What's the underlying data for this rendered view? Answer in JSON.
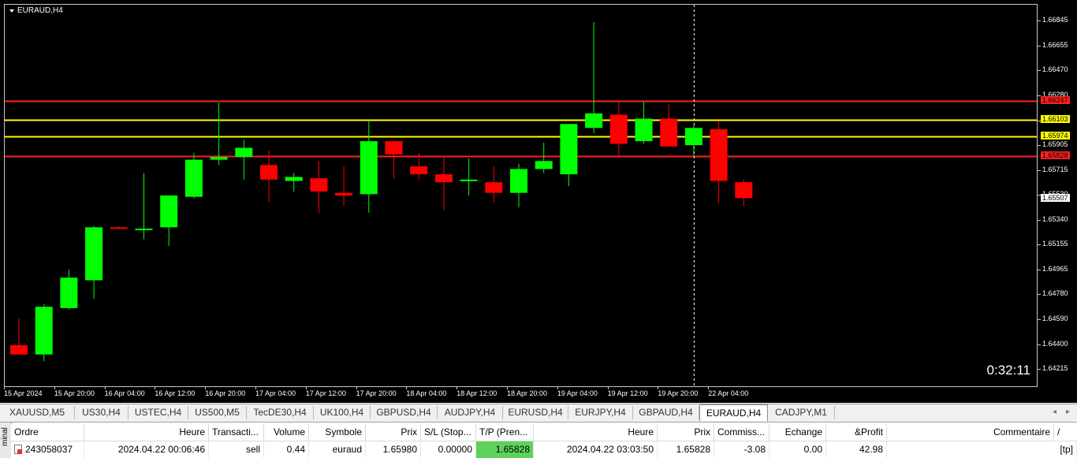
{
  "chart": {
    "title": "EURAUD,H4",
    "countdown": "0:32:11",
    "colors": {
      "bull": "#00ff00",
      "bear": "#ff0000",
      "background": "#000000",
      "wick_bull": "#00ff00",
      "wick_bear": "#ff0000"
    },
    "price_ticks": [
      "1.66845",
      "1.66655",
      "1.66470",
      "1.66280",
      "1.66090",
      "1.65905",
      "1.65715",
      "1.65530",
      "1.65340",
      "1.65155",
      "1.64965",
      "1.64780",
      "1.64590",
      "1.64400",
      "1.64215"
    ],
    "price_labels": [
      {
        "text": "1.66247",
        "bg": "#ff2020",
        "fg": "#000000"
      },
      {
        "text": "1.66103",
        "bg": "#ffff00",
        "fg": "#000000"
      },
      {
        "text": "1.65974",
        "bg": "#ffff00",
        "fg": "#000000"
      },
      {
        "text": "1.65828",
        "bg": "#ff2020",
        "fg": "#000000"
      },
      {
        "text": "1.65507",
        "bg": "#ffffff",
        "fg": "#000000"
      }
    ],
    "time_labels": [
      "15 Apr 2024",
      "15 Apr 20:00",
      "16 Apr 04:00",
      "16 Apr 12:00",
      "16 Apr 20:00",
      "17 Apr 04:00",
      "17 Apr 12:00",
      "17 Apr 20:00",
      "18 Apr 04:00",
      "18 Apr 12:00",
      "18 Apr 20:00",
      "19 Apr 04:00",
      "19 Apr 12:00",
      "19 Apr 20:00",
      "22 Apr 04:00"
    ]
  },
  "chart_data": {
    "type": "candlestick",
    "symbol": "EURAUD",
    "timeframe": "H4",
    "ylim": [
      1.6415,
      1.669
    ],
    "hlines": [
      {
        "price": 1.66247,
        "color": "#ff2020"
      },
      {
        "price": 1.66103,
        "color": "#ffff00"
      },
      {
        "price": 1.65974,
        "color": "#ffff00"
      },
      {
        "price": 1.65828,
        "color": "#ff2020"
      }
    ],
    "candles": [
      {
        "o": 1.644,
        "h": 1.646,
        "l": 1.6433,
        "c": 1.6433
      },
      {
        "o": 1.6433,
        "h": 1.6471,
        "l": 1.6428,
        "c": 1.6469
      },
      {
        "o": 1.6468,
        "h": 1.6497,
        "l": 1.6467,
        "c": 1.6491
      },
      {
        "o": 1.6489,
        "h": 1.653,
        "l": 1.6475,
        "c": 1.6529
      },
      {
        "o": 1.6529,
        "h": 1.653,
        "l": 1.6528,
        "c": 1.6528
      },
      {
        "o": 1.6528,
        "h": 1.657,
        "l": 1.652,
        "c": 1.6528
      },
      {
        "o": 1.6529,
        "h": 1.6553,
        "l": 1.6515,
        "c": 1.6553
      },
      {
        "o": 1.6552,
        "h": 1.6585,
        "l": 1.6551,
        "c": 1.658
      },
      {
        "o": 1.658,
        "h": 1.6623,
        "l": 1.6576,
        "c": 1.6582
      },
      {
        "o": 1.6582,
        "h": 1.6595,
        "l": 1.6565,
        "c": 1.6589
      },
      {
        "o": 1.6576,
        "h": 1.6587,
        "l": 1.6548,
        "c": 1.6565
      },
      {
        "o": 1.6564,
        "h": 1.657,
        "l": 1.6556,
        "c": 1.6567
      },
      {
        "o": 1.6566,
        "h": 1.6579,
        "l": 1.654,
        "c": 1.6556
      },
      {
        "o": 1.6555,
        "h": 1.6575,
        "l": 1.6545,
        "c": 1.6553
      },
      {
        "o": 1.6554,
        "h": 1.6609,
        "l": 1.654,
        "c": 1.6594
      },
      {
        "o": 1.6594,
        "h": 1.6594,
        "l": 1.6566,
        "c": 1.6584
      },
      {
        "o": 1.6575,
        "h": 1.6585,
        "l": 1.6565,
        "c": 1.6569
      },
      {
        "o": 1.6569,
        "h": 1.6583,
        "l": 1.6542,
        "c": 1.6563
      },
      {
        "o": 1.6564,
        "h": 1.6581,
        "l": 1.6553,
        "c": 1.6565
      },
      {
        "o": 1.6563,
        "h": 1.6575,
        "l": 1.6548,
        "c": 1.6555
      },
      {
        "o": 1.6555,
        "h": 1.6577,
        "l": 1.6544,
        "c": 1.6573
      },
      {
        "o": 1.6573,
        "h": 1.6593,
        "l": 1.657,
        "c": 1.6579
      },
      {
        "o": 1.6569,
        "h": 1.6607,
        "l": 1.656,
        "c": 1.6607
      },
      {
        "o": 1.6604,
        "h": 1.6684,
        "l": 1.66,
        "c": 1.6615
      },
      {
        "o": 1.6614,
        "h": 1.6624,
        "l": 1.6583,
        "c": 1.6592
      },
      {
        "o": 1.6594,
        "h": 1.6624,
        "l": 1.6592,
        "c": 1.6611
      },
      {
        "o": 1.6611,
        "h": 1.6622,
        "l": 1.659,
        "c": 1.659
      },
      {
        "o": 1.6591,
        "h": 1.6606,
        "l": 1.6583,
        "c": 1.6604
      },
      {
        "o": 1.6603,
        "h": 1.6609,
        "l": 1.6547,
        "c": 1.6564
      },
      {
        "o": 1.6563,
        "h": 1.6565,
        "l": 1.6545,
        "c": 1.6551
      }
    ]
  },
  "tabs": {
    "items": [
      {
        "label": "XAUUSD,M5"
      },
      {
        "label": "US30,H4"
      },
      {
        "label": "USTEC,H4"
      },
      {
        "label": "US500,M5"
      },
      {
        "label": "TecDE30,H4"
      },
      {
        "label": "UK100,H4"
      },
      {
        "label": "GBPUSD,H4"
      },
      {
        "label": "AUDJPY,H4"
      },
      {
        "label": "EURUSD,H4"
      },
      {
        "label": "EURJPY,H4"
      },
      {
        "label": "GBPAUD,H4"
      },
      {
        "label": "EURAUD,H4",
        "active": true
      },
      {
        "label": "CADJPY,M1"
      }
    ],
    "scroll_left": "◂",
    "scroll_right": "▸"
  },
  "terminal": {
    "side_label": "minal",
    "headers": {
      "order": "Ordre",
      "time": "Heure",
      "type": "Transacti...",
      "volume": "Volume",
      "symbol": "Symbole",
      "price": "Prix",
      "sl": "S/L (Stop...",
      "tp": "T/P (Pren...",
      "close_time": "Heure",
      "close_price": "Prix",
      "commission": "Commiss...",
      "swap": "Echange",
      "profit": "&Profit",
      "comment": "Commentaire",
      "sort_icon": "/"
    },
    "row": {
      "order": "243058037",
      "time": "2024.04.22 00:06:46",
      "type": "sell",
      "volume": "0.44",
      "symbol": "euraud",
      "price": "1.65980",
      "sl": "0.00000",
      "tp": "1.65828",
      "close_time": "2024.04.22 03:03:50",
      "close_price": "1.65828",
      "commission": "-3.08",
      "swap": "0.00",
      "profit": "42.98",
      "comment": "[tp]"
    }
  }
}
